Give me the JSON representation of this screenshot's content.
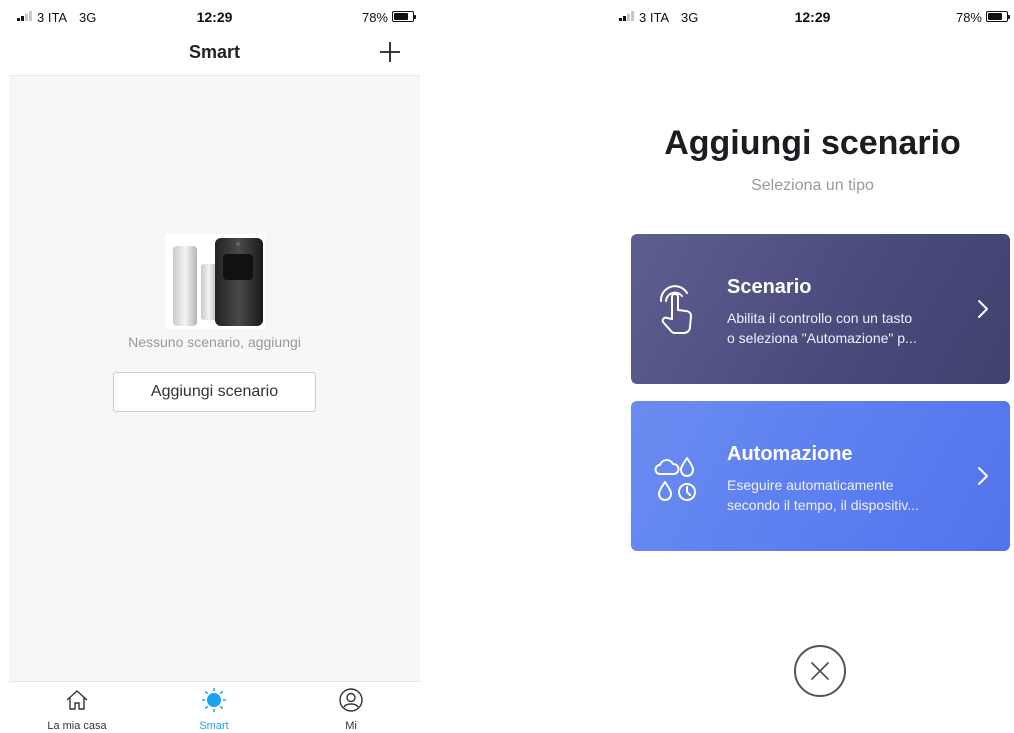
{
  "status_left": {
    "carrier": "3 ITA",
    "network": "3G",
    "time": "12:29",
    "battery": "78%"
  },
  "status_right": {
    "carrier": "3 ITA",
    "network": "3G",
    "time": "12:29",
    "battery": "78%"
  },
  "smart": {
    "title": "Smart",
    "empty_message": "Nessuno scenario, aggiungi",
    "add_button_label": "Aggiungi scenario"
  },
  "tab_bar": {
    "tabs": [
      {
        "label": "La mia casa",
        "icon": "home-icon"
      },
      {
        "label": "Smart",
        "icon": "sun-icon",
        "active": true
      },
      {
        "label": "Mi",
        "icon": "profile-icon"
      }
    ],
    "active_color": "#1aa3f0"
  },
  "add_scene": {
    "title": "Aggiungi scenario",
    "subtitle": "Seleziona un tipo",
    "cards": [
      {
        "title": "Scenario",
        "desc_line1": "Abilita il controllo con un tasto",
        "desc_line2": "o seleziona \"Automazione\" p...",
        "icon": "touch-hand-icon",
        "color": "#4f507f"
      },
      {
        "title": "Automazione",
        "desc_line1": "Eseguire automaticamente",
        "desc_line2": "secondo il tempo, il dispositiv...",
        "icon": "weather-clock-icon",
        "color": "#5c7ef0"
      }
    ],
    "close_icon": "close-icon"
  }
}
